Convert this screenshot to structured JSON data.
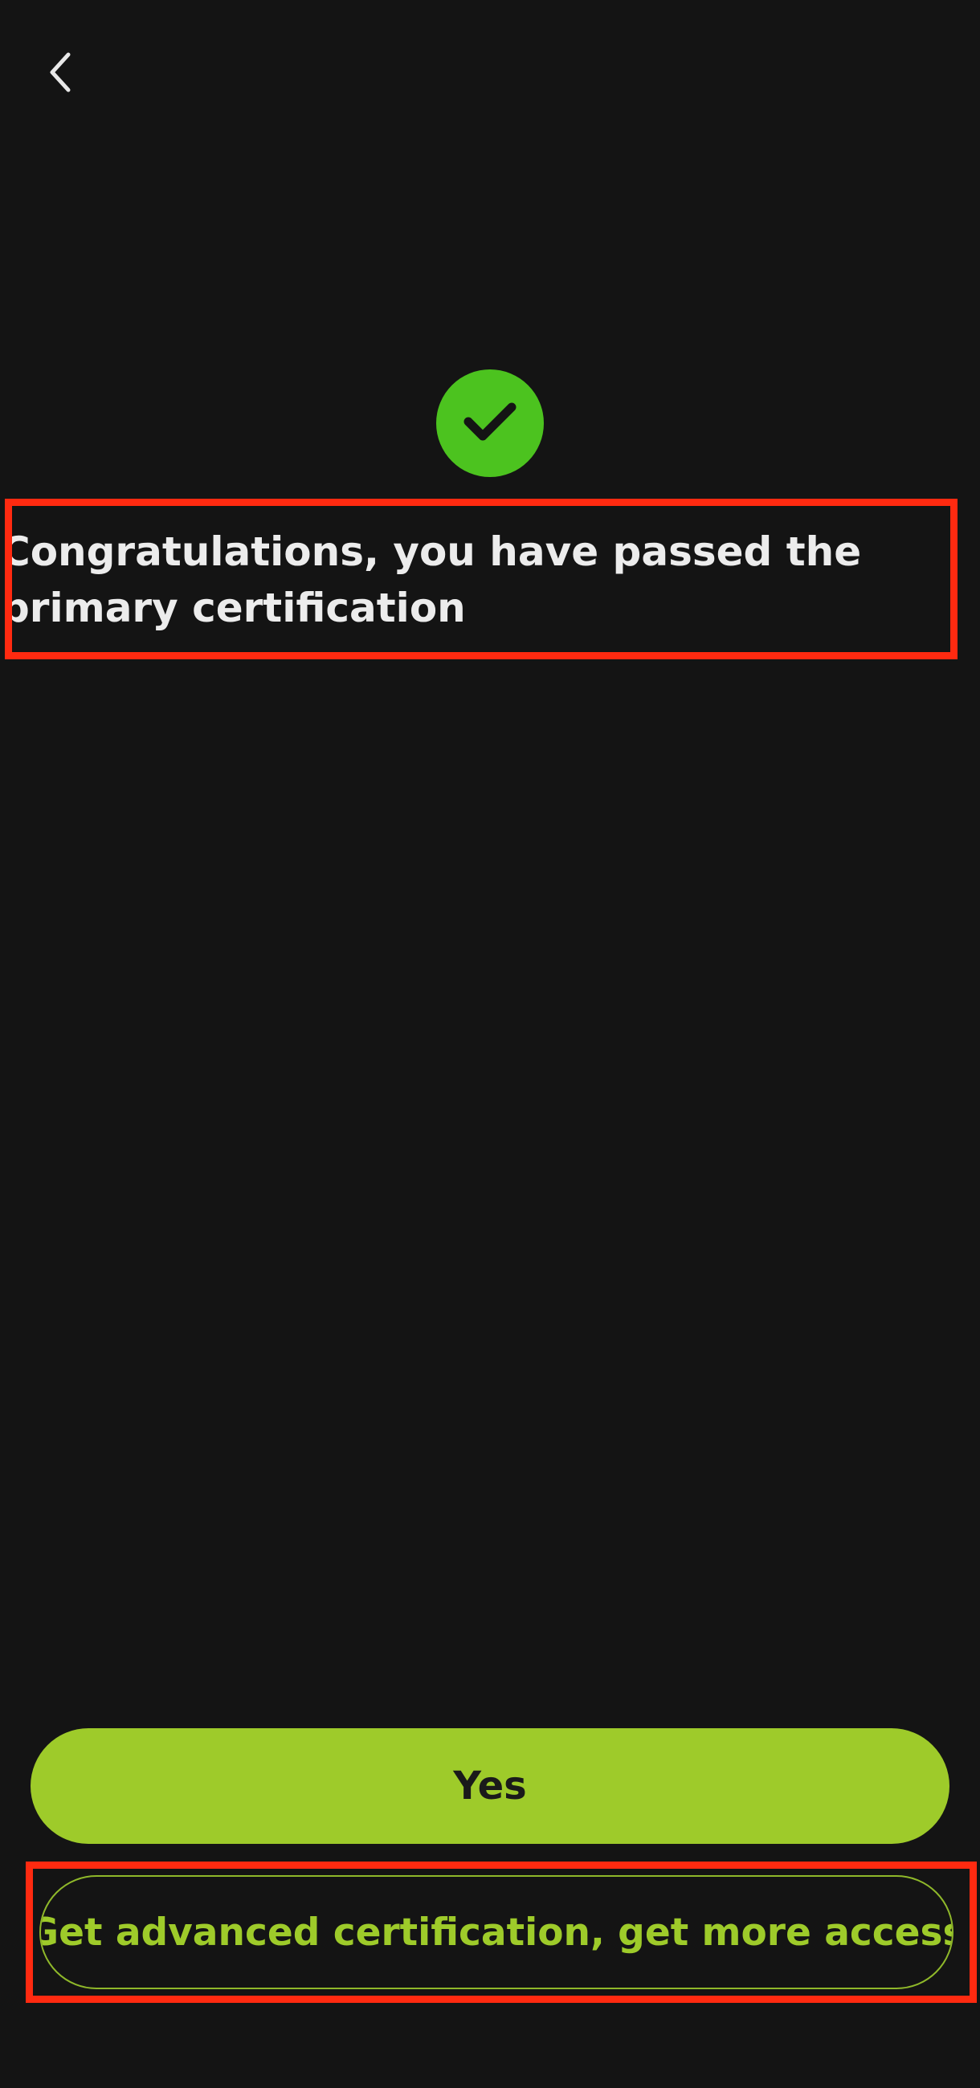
{
  "colors": {
    "background": "#141414",
    "accent_lime": "#9ecb2a",
    "success_green": "#4cc31f",
    "title_text": "#ececec",
    "highlight_red": "#ff2a10"
  },
  "header": {
    "back_icon": "chevron-left-icon"
  },
  "success": {
    "icon": "checkmark-icon"
  },
  "message": {
    "title": "Congratulations, you have passed the primary certification"
  },
  "actions": {
    "yes_label": "Yes",
    "advanced_label": "Get advanced certification, get more access"
  }
}
